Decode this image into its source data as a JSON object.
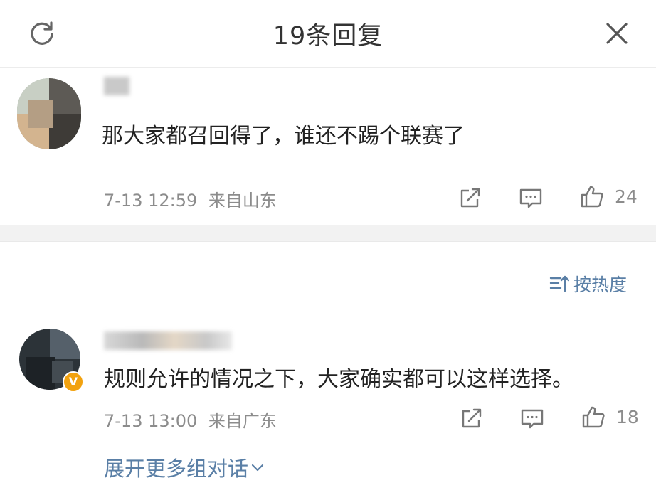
{
  "header": {
    "title": "19条回复",
    "refresh_icon": "refresh-icon",
    "close_icon": "close-icon"
  },
  "root_comment": {
    "text": "那大家都召回得了，谁还不踢个联赛了",
    "time": "7-13 12:59",
    "location": "来自山东",
    "like_count": "24"
  },
  "sort": {
    "label": "按热度",
    "icon": "sort-icon"
  },
  "replies": [
    {
      "text": "规则允许的情况之下，大家确实都可以这样选择。",
      "time": "7-13 13:00",
      "location": "来自广东",
      "like_count": "18",
      "verified_badge": "V",
      "badge_color": "#f2a20f"
    }
  ],
  "expand_link": "展开更多组对话",
  "colors": {
    "link": "#5a7fa6",
    "meta": "#8c8c8c",
    "divider": "#f2f2f2"
  }
}
